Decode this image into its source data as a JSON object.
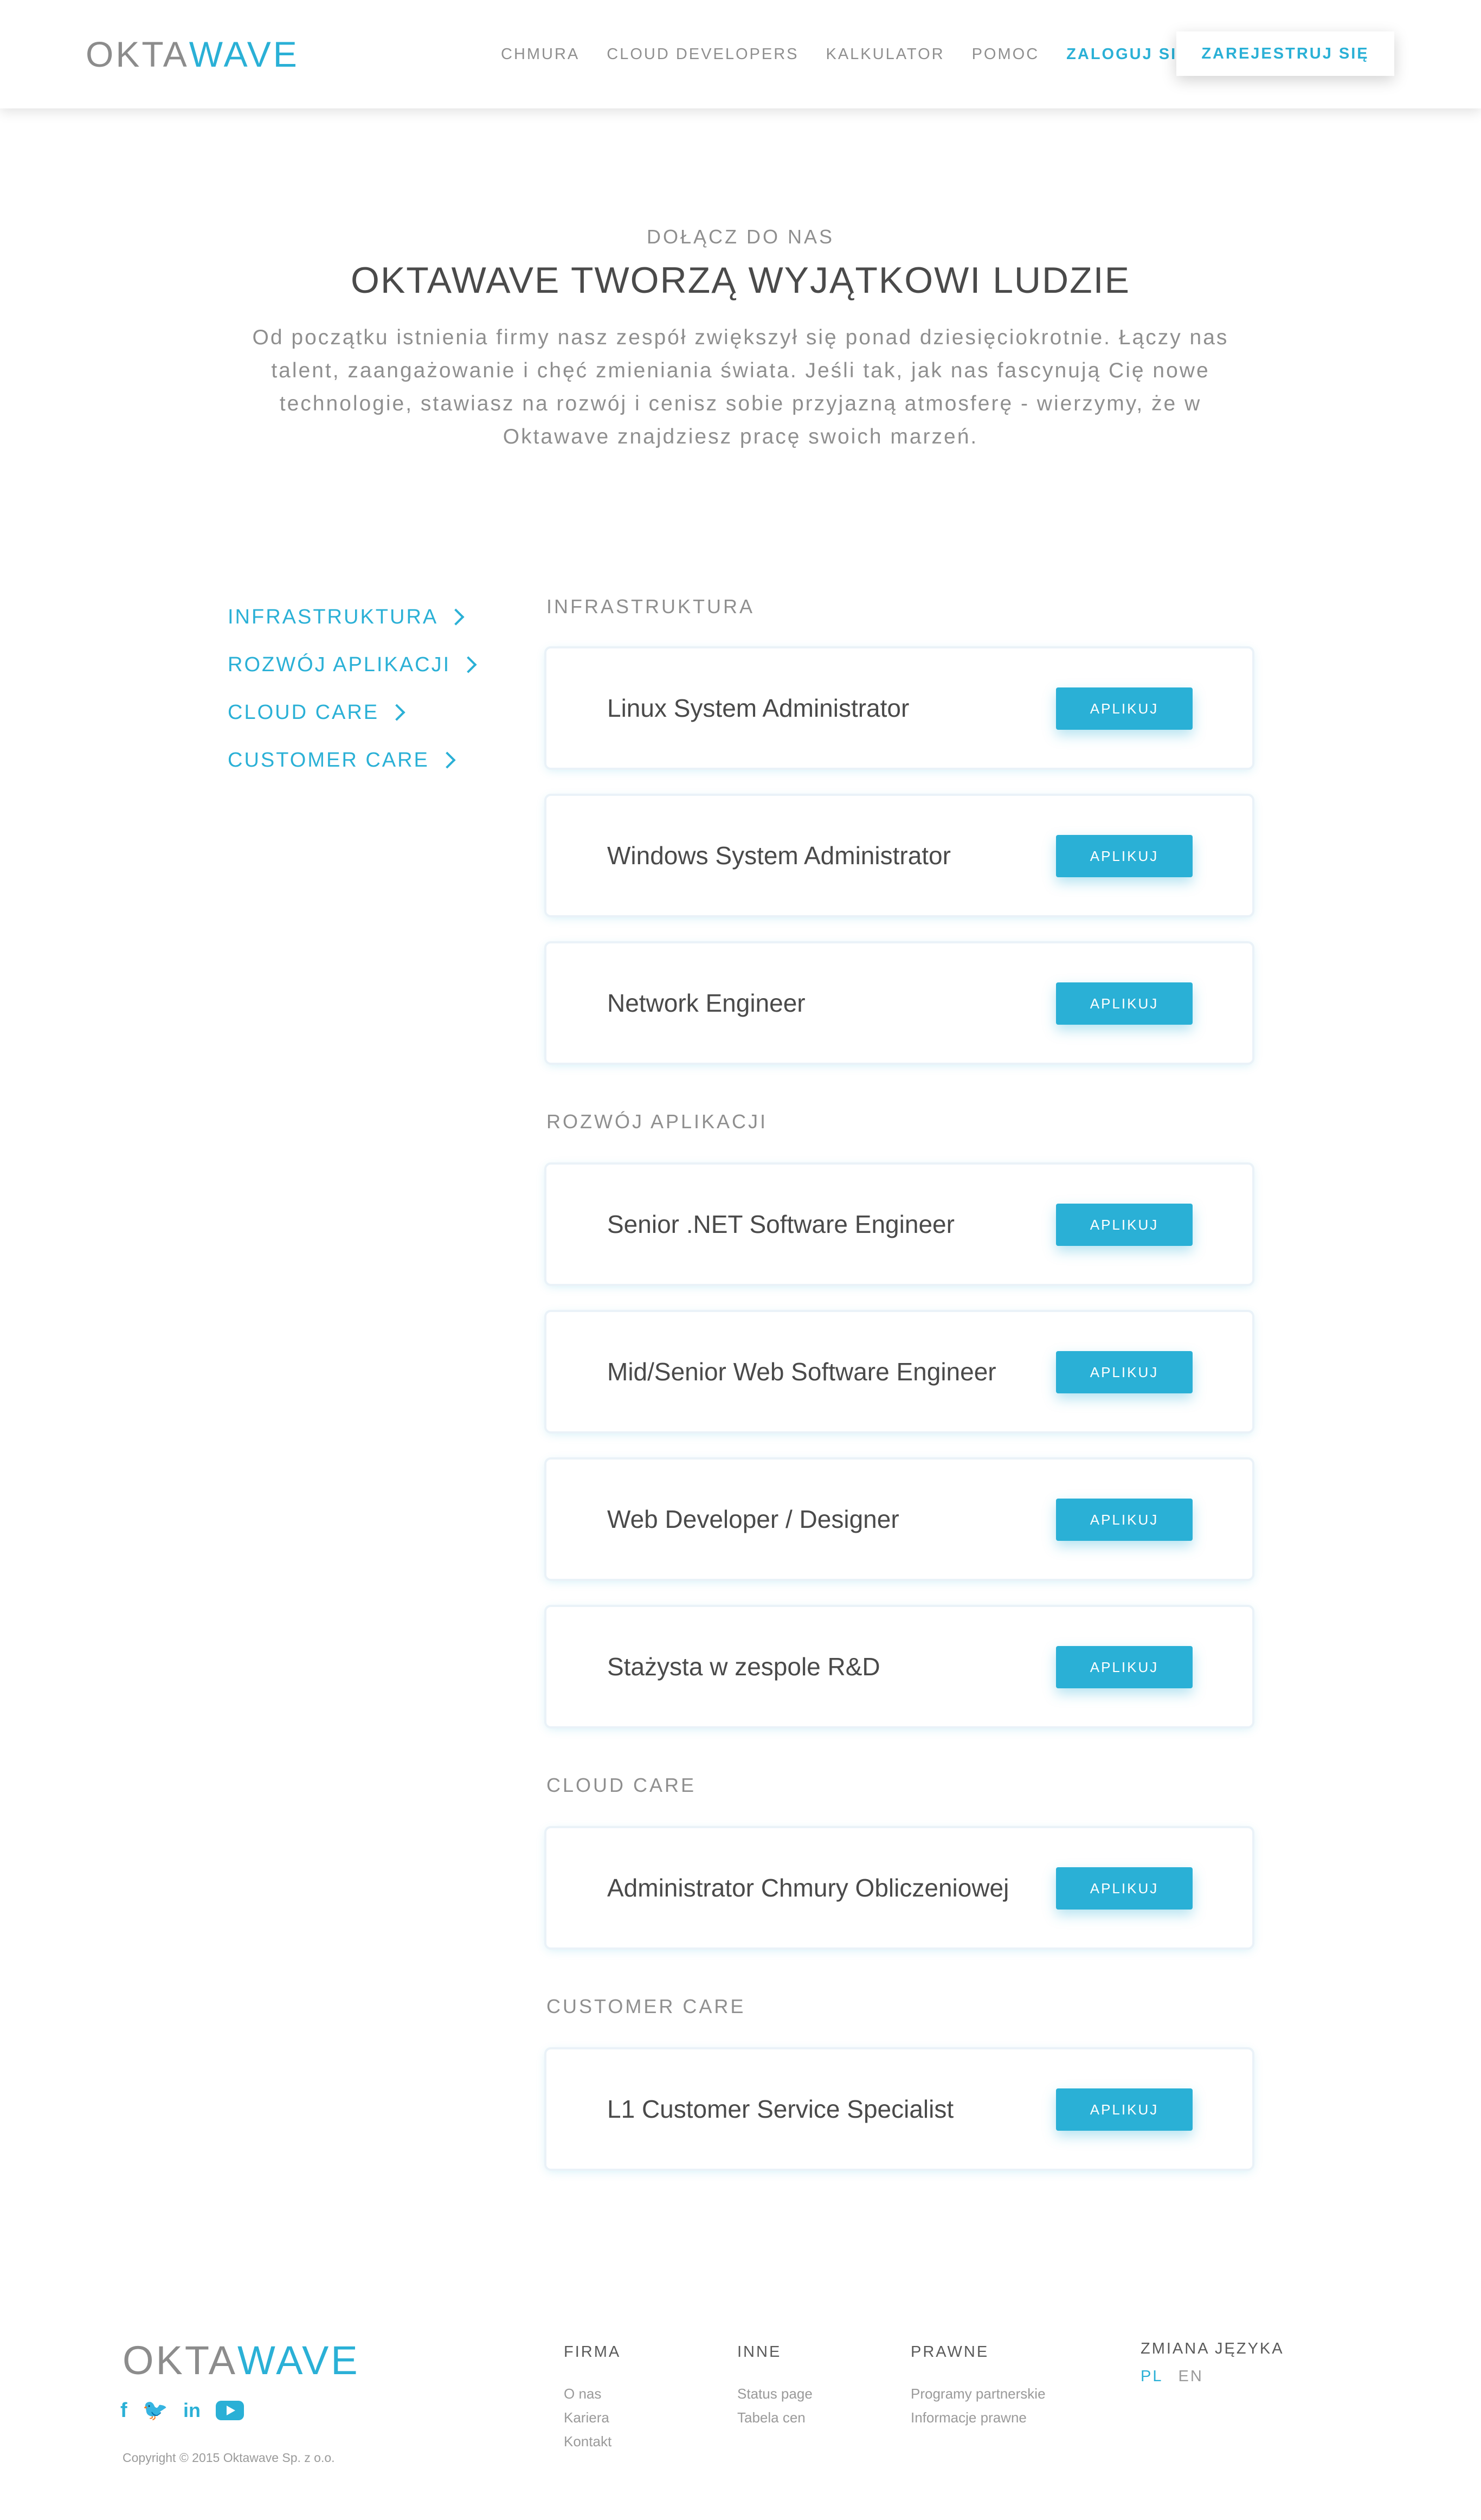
{
  "header": {
    "logo_part1": "OKTA",
    "logo_part2": "WAVE",
    "nav": [
      "CHMURA",
      "CLOUD DEVELOPERS",
      "KALKULATOR",
      "POMOC"
    ],
    "login": "ZALOGUJ SIĘ",
    "register": "ZAREJESTRUJ SIĘ"
  },
  "hero": {
    "kicker": "DOŁĄCZ DO NAS",
    "title": "OKTAWAVE TWORZĄ WYJĄTKOWI LUDZIE",
    "text": "Od początku istnienia firmy nasz zespół zwiększył się ponad dziesięciokrotnie. Łączy nas talent, zaangażowanie i chęć zmieniania świata. Jeśli tak, jak nas fascynują Cię nowe technologie, stawiasz na rozwój i cenisz sobie przyjazną atmosferę - wierzymy, że w Oktawave znajdziesz pracę swoich marzeń."
  },
  "sidebar": [
    "INFRASTRUKTURA",
    "ROZWÓJ APLIKACJI",
    "CLOUD CARE",
    "CUSTOMER CARE"
  ],
  "apply_label": "APLIKUJ",
  "sections": [
    {
      "title": "INFRASTRUKTURA",
      "jobs": [
        "Linux System Administrator",
        "Windows System Administrator",
        "Network Engineer"
      ]
    },
    {
      "title": "ROZWÓJ APLIKACJI",
      "jobs": [
        "Senior .NET Software Engineer",
        "Mid/Senior Web Software Engineer",
        "Web Developer / Designer",
        "Stażysta w zespole R&D"
      ]
    },
    {
      "title": "CLOUD CARE",
      "jobs": [
        "Administrator Chmury Obliczeniowej"
      ]
    },
    {
      "title": "CUSTOMER CARE",
      "jobs": [
        "L1 Customer Service Specialist"
      ]
    }
  ],
  "footer": {
    "logo_part1": "OKTA",
    "logo_part2": "WAVE",
    "social": {
      "facebook": "f",
      "twitter": "🐦",
      "linkedin": "in"
    },
    "copyright": "Copyright © 2015 Oktawave Sp. z o.o.",
    "columns": [
      {
        "title": "FIRMA",
        "links": [
          "O nas",
          "Kariera",
          "Kontakt"
        ]
      },
      {
        "title": "INNE",
        "links": [
          "Status page",
          "Tabela cen"
        ]
      },
      {
        "title": "PRAWNE",
        "links": [
          "Programy partnerskie",
          "Informacje prawne"
        ]
      }
    ],
    "language": {
      "title": "ZMIANA JĘZYKA",
      "options": [
        "PL",
        "EN"
      ]
    }
  },
  "colors": {
    "accent": "#2ab0d6",
    "text": "#4a4a4a",
    "muted": "#8f8f8f"
  },
  "icons": [
    "chevron-right-icon",
    "facebook-icon",
    "twitter-icon",
    "linkedin-icon",
    "youtube-icon"
  ]
}
